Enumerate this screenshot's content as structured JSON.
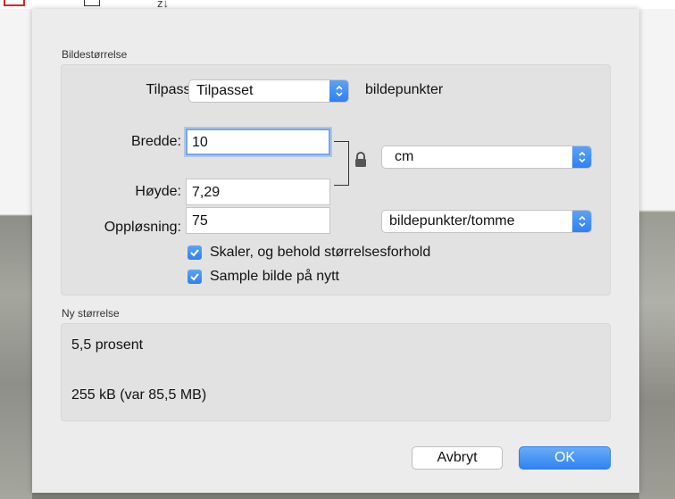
{
  "size_section": {
    "title": "Bildestørrelse",
    "fit_label": "Tilpass til:",
    "fit_value": "Tilpasset",
    "fit_unit": "bildepunkter",
    "width_label": "Bredde:",
    "width_value": "10",
    "height_label": "Høyde:",
    "height_value": "7,29",
    "dimension_unit": "cm",
    "resolution_label": "Oppløsning:",
    "resolution_value": "75",
    "resolution_unit": "bildepunkter/tomme",
    "scale_checkbox": "Skaler, og behold størrelsesforhold",
    "scale_checked": true,
    "resample_checkbox": "Sample bilde på nytt",
    "resample_checked": true
  },
  "new_size_section": {
    "title": "Ny størrelse",
    "percent": "5,5 prosent",
    "file_size": "255 kB (var 85,5 MB)"
  },
  "buttons": {
    "cancel": "Avbryt",
    "ok": "OK"
  },
  "colors": {
    "accent": "#2f83f2",
    "focus_ring": "#74a6e8"
  }
}
